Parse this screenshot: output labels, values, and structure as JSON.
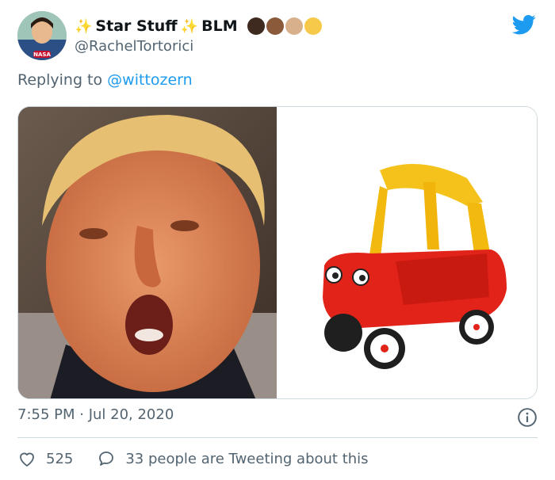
{
  "author": {
    "display_name_prefix": "Star Stuff",
    "display_name_suffix": "BLM",
    "handle": "@RachelTortorici",
    "fist_colors": [
      "#3e2a1e",
      "#8a5a3b",
      "#d8b08c",
      "#f7c94a"
    ],
    "avatar_badge": "NASA"
  },
  "reply": {
    "prefix": "Replying to",
    "mention": "@wittozern"
  },
  "media": {
    "left_icon": "person-photo",
    "right_icon": "toy-car-photo"
  },
  "meta": {
    "timestamp": "7:55 PM · Jul 20, 2020"
  },
  "actions": {
    "likes": "525",
    "tweeting_about": "33 people are Tweeting about this"
  },
  "colors": {
    "accent": "#1d9bf0",
    "secondary_text": "#536471",
    "border": "#cfd9de"
  }
}
